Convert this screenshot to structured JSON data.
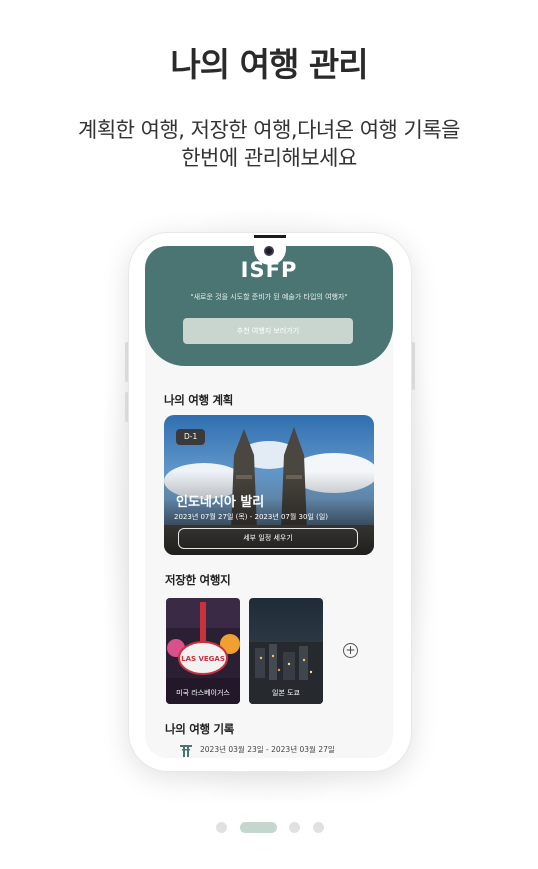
{
  "page": {
    "title": "나의 여행 관리",
    "subtitle_line1": "계획한 여행, 저장한 여행,다녀온 여행 기록을",
    "subtitle_line2": "한번에 관리해보세요"
  },
  "app": {
    "hero": {
      "type": "ISFP",
      "quote": "\"새로운 것을 시도할 준비가 된 예술가 타입의 여행자\"",
      "button": "추천 여행지 보러가기"
    },
    "plan_section": {
      "title": "나의 여행 계획",
      "card": {
        "dday": "D-1",
        "name": "인도네시아 발리",
        "dates": "2023년 07월 27일 (목) - 2023년 07월 30일 (일)",
        "button": "세부 일정 세우기"
      }
    },
    "saved_section": {
      "title": "저장한 여행지",
      "items": [
        {
          "label": "미국 라스베이거스"
        },
        {
          "label": "일본 도쿄"
        }
      ],
      "sign_text": "LAS VEGAS"
    },
    "record_section": {
      "title": "나의 여행 기록",
      "dates": "2023년 03월 23일 - 2023년 03월 27일"
    }
  },
  "pagination": {
    "total": 4,
    "active": 2
  },
  "colors": {
    "hero": "#4a7572",
    "hero_button": "#c9d6d0",
    "active_dot": "#c5d6cf",
    "inactive_dot": "#e1e1e1",
    "record_icon": "#4a7572"
  }
}
